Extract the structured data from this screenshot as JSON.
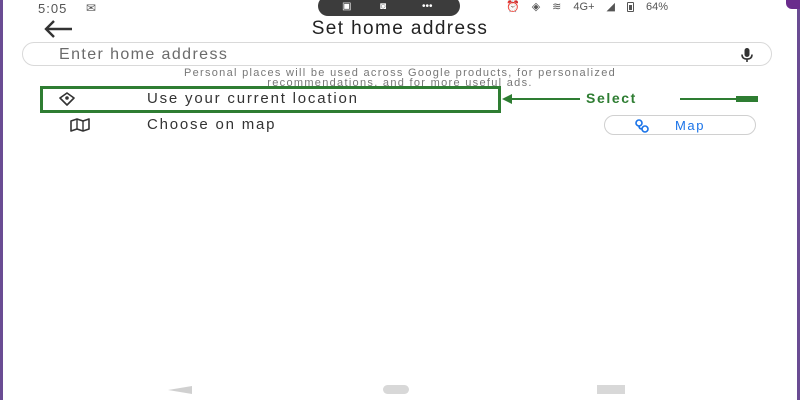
{
  "status_bar": {
    "time": "5:05",
    "network": "4G+",
    "battery": "64%"
  },
  "header": {
    "title": "Set home address"
  },
  "search": {
    "placeholder": "Enter home address",
    "value": ""
  },
  "disclaimer": {
    "line1": "Personal places will be used across Google products, for personalized",
    "line2": "recommendations, and for more useful ads."
  },
  "options": {
    "current_location": "Use your current location",
    "choose_on_map": "Choose on map"
  },
  "map_chip": {
    "label": "Map"
  },
  "annotation": {
    "label": "Select"
  },
  "colors": {
    "annotation_green": "#2e7d32",
    "chip_blue": "#1a73e8",
    "frame_purple": "#6a4c93"
  },
  "icons": {
    "back": "arrow-left",
    "mic": "microphone",
    "current_location": "location-pin",
    "map_option": "map-fold",
    "map_chip": "map-route"
  }
}
